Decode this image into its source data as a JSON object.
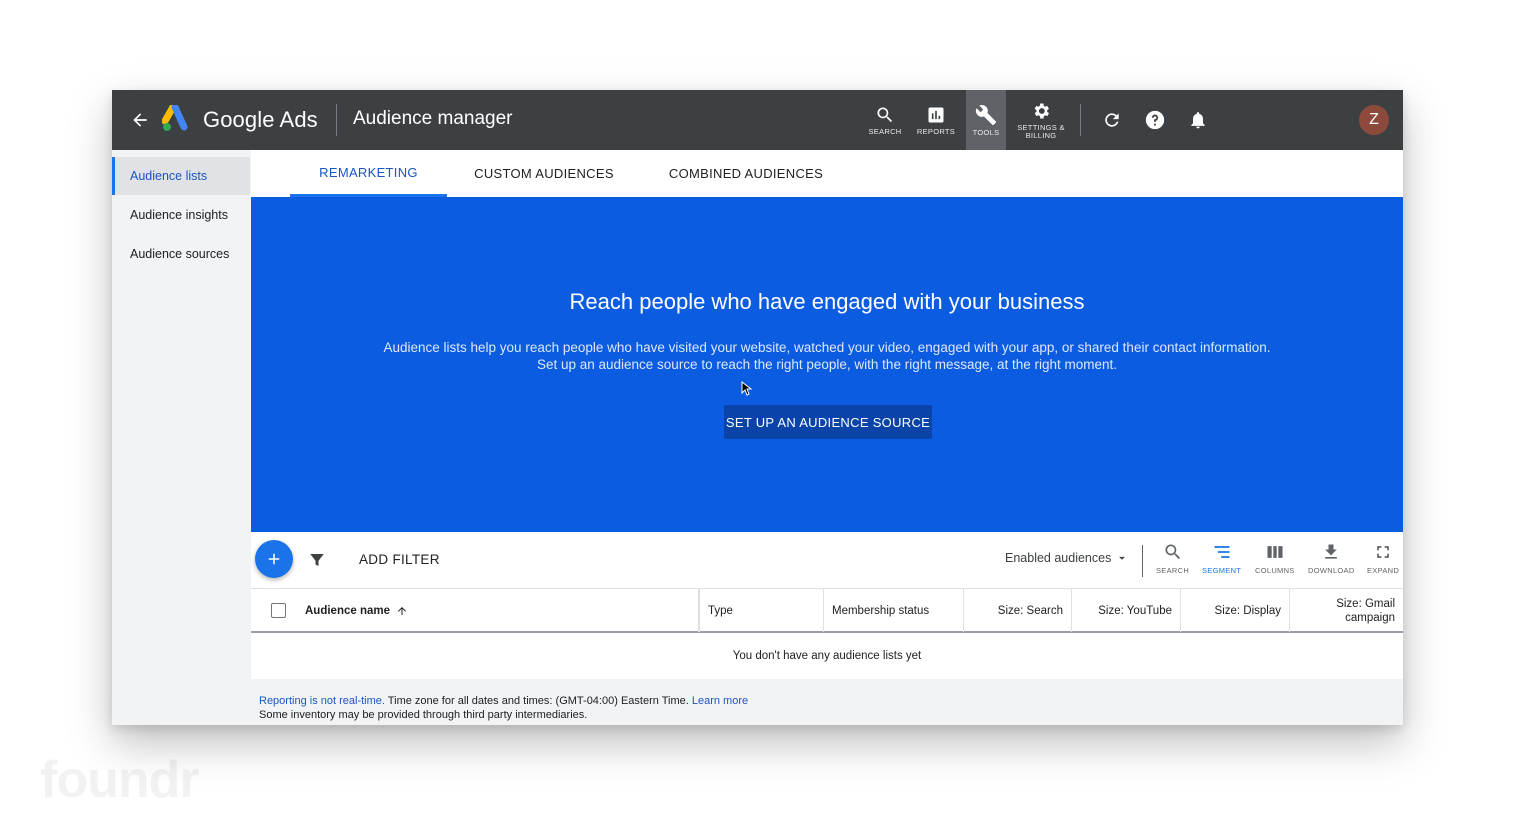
{
  "topbar": {
    "brand": "Google Ads",
    "page_title": "Audience manager",
    "tools": [
      {
        "label": "SEARCH",
        "icon": "search-icon"
      },
      {
        "label": "REPORTS",
        "icon": "reports-icon"
      },
      {
        "label": "TOOLS",
        "icon": "wrench-icon"
      },
      {
        "label_line1": "SETTINGS &",
        "label_line2": "BILLING",
        "icon": "gear-icon"
      }
    ],
    "avatar_letter": "Z"
  },
  "sidebar": {
    "items": [
      {
        "label": "Audience lists",
        "active": true
      },
      {
        "label": "Audience insights",
        "active": false
      },
      {
        "label": "Audience sources",
        "active": false
      }
    ]
  },
  "tabs": [
    {
      "label": "REMARKETING",
      "active": true
    },
    {
      "label": "CUSTOM AUDIENCES",
      "active": false
    },
    {
      "label": "COMBINED AUDIENCES",
      "active": false
    }
  ],
  "hero": {
    "title": "Reach people who have engaged with your business",
    "description": "Audience lists help you reach people who have visited your website, watched your video, engaged with your app, or shared their contact information. Set up an audience source to reach the right people, with the right message, at the right moment.",
    "button": "SET UP AN AUDIENCE SOURCE",
    "background_color": "#0b5ce1"
  },
  "toolbar": {
    "add_filter": "ADD FILTER",
    "dropdown": "Enabled audiences",
    "tools": [
      {
        "label": "SEARCH",
        "icon": "search-icon"
      },
      {
        "label": "SEGMENT",
        "icon": "segment-icon",
        "active": true
      },
      {
        "label": "COLUMNS",
        "icon": "columns-icon"
      },
      {
        "label": "DOWNLOAD",
        "icon": "download-icon"
      },
      {
        "label": "EXPAND",
        "icon": "expand-icon"
      }
    ]
  },
  "table": {
    "columns": [
      {
        "label": "Audience name"
      },
      {
        "label": "Type"
      },
      {
        "label": "Membership status"
      },
      {
        "label": "Size: Search"
      },
      {
        "label": "Size: YouTube"
      },
      {
        "label": "Size: Display"
      },
      {
        "label_line1": "Size: Gmail",
        "label_line2": "campaign"
      }
    ],
    "empty_message": "You don't have any audience lists yet"
  },
  "footer": {
    "reporting_link": "Reporting is not real-time.",
    "timezone_text": " Time zone for all dates and times: (GMT-04:00) Eastern Time. ",
    "learn_more": "Learn more",
    "line2": "Some inventory may be provided through third party intermediaries."
  },
  "watermark": "foundr",
  "colors": {
    "accent": "#1a73e8",
    "topbar": "#3c4043"
  }
}
